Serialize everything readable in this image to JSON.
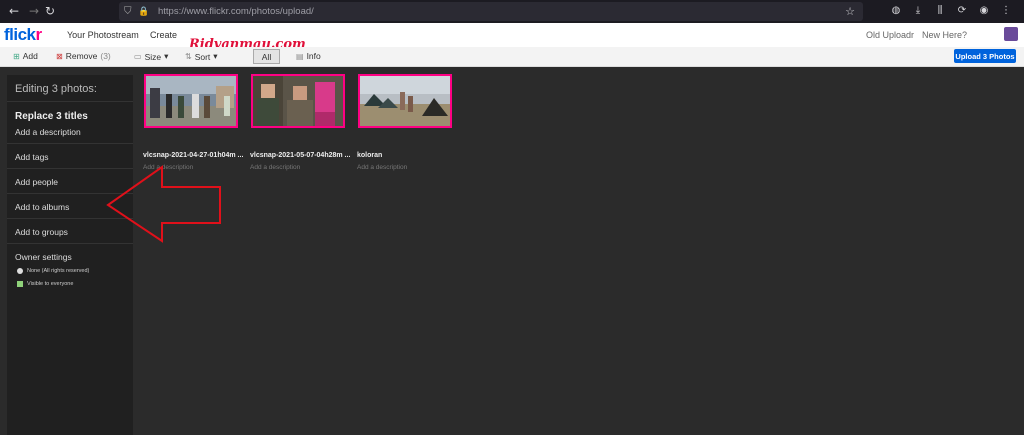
{
  "browser": {
    "url_domain": "https://www.flickr.com",
    "url_path": "/photos/upload/"
  },
  "header": {
    "logo_a": "flick",
    "logo_b": "r",
    "nav": [
      "Your Photostream",
      "Create"
    ],
    "watermark": "Ridvanmau.com",
    "right_links": [
      "Old Uploadr",
      "New Here?"
    ]
  },
  "toolbar": {
    "add_label": "Add",
    "remove_label": "Remove",
    "remove_count": "(3)",
    "size_label": "Size",
    "sort_label": "Sort",
    "all_label": "All",
    "info_label": "Info",
    "upload_label": "Upload 3 Photos"
  },
  "sidebar": {
    "heading": "Editing 3 photos:",
    "title": "Replace 3 titles",
    "items": [
      "Add a description",
      "Add tags",
      "Add people",
      "Add to albums",
      "Add to groups"
    ],
    "owner_settings": "Owner settings",
    "license": "None (All rights reserved)",
    "visibility": "Visible to everyone"
  },
  "photos": [
    {
      "title": "vlcsnap-2021-04-27-01h04m ...",
      "desc": "Add a description"
    },
    {
      "title": "vlcsnap-2021-05-07-04h28m ...",
      "desc": "Add a description"
    },
    {
      "title": "koloran",
      "desc": "Add a description"
    }
  ],
  "colors": {
    "accent_blue": "#0063dc",
    "accent_pink": "#ff0084",
    "arrow_red": "#e0101a"
  }
}
